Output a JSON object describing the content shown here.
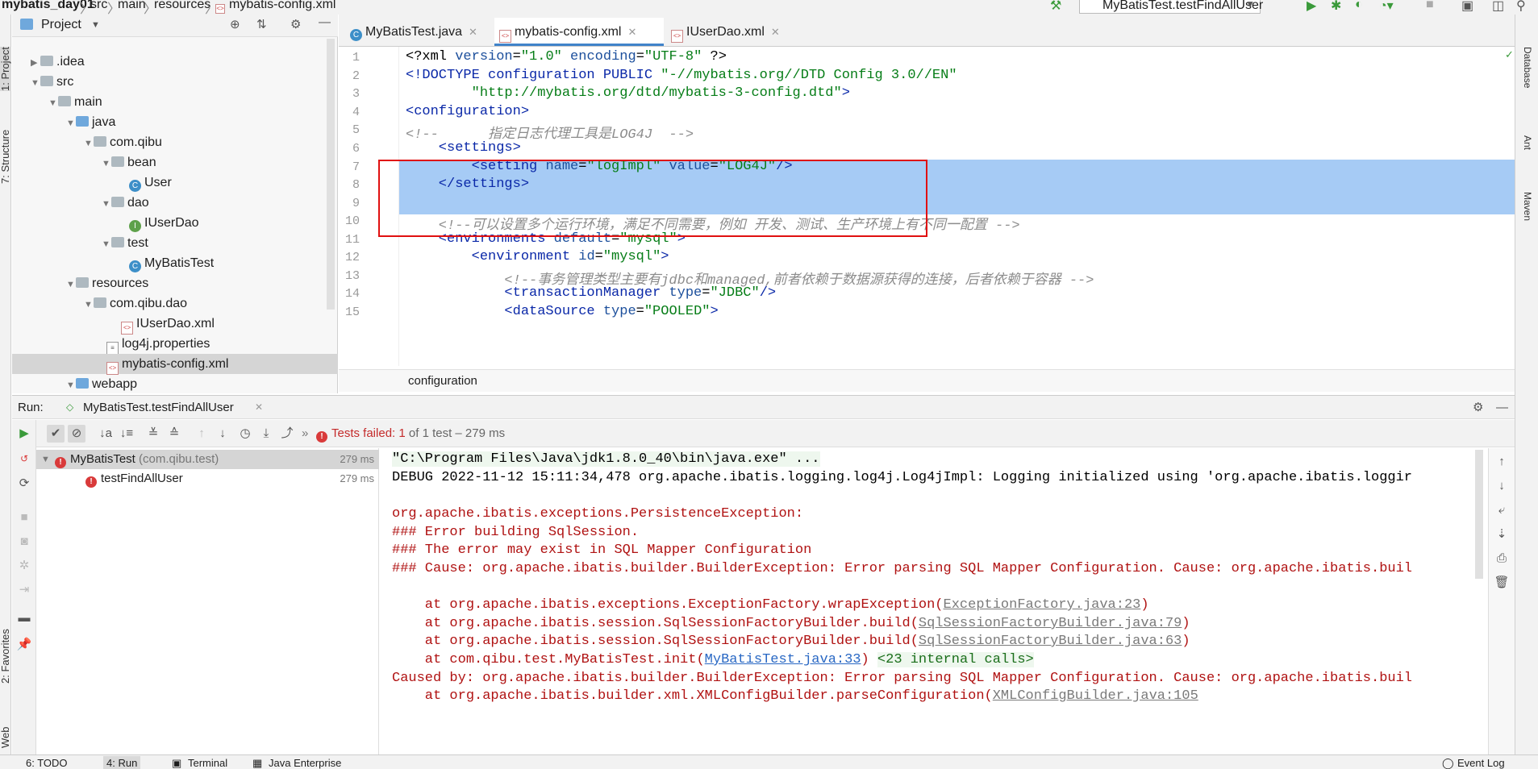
{
  "topbar": {
    "crumbs": [
      "mybatis_day01",
      "src",
      "main",
      "resources",
      "mybatis-config.xml"
    ],
    "run_config": "MyBatisTest.testFindAllUser"
  },
  "left_strip": {
    "project": "1: Project",
    "structure": "7: Structure",
    "favorites": "2: Favorites",
    "web": "Web"
  },
  "right_strip": {
    "database": "Database",
    "ant": "Ant",
    "maven": "Maven"
  },
  "project_panel": {
    "title": "Project",
    "tree": [
      {
        "label": ".idea",
        "kind": "folder"
      },
      {
        "label": "src",
        "kind": "folder"
      },
      {
        "label": "main",
        "kind": "folder"
      },
      {
        "label": "java",
        "kind": "folder-blue"
      },
      {
        "label": "com.qibu",
        "kind": "package"
      },
      {
        "label": "bean",
        "kind": "package"
      },
      {
        "label": "User",
        "kind": "class"
      },
      {
        "label": "dao",
        "kind": "package"
      },
      {
        "label": "IUserDao",
        "kind": "interface"
      },
      {
        "label": "test",
        "kind": "package"
      },
      {
        "label": "MyBatisTest",
        "kind": "class"
      },
      {
        "label": "resources",
        "kind": "folder"
      },
      {
        "label": "com.qibu.dao",
        "kind": "package"
      },
      {
        "label": "IUserDao.xml",
        "kind": "xml"
      },
      {
        "label": "log4j.properties",
        "kind": "properties"
      },
      {
        "label": "mybatis-config.xml",
        "kind": "xml"
      },
      {
        "label": "webapp",
        "kind": "folder"
      }
    ]
  },
  "tabs": [
    {
      "label": "MyBatisTest.java"
    },
    {
      "label": "mybatis-config.xml"
    },
    {
      "label": "IUserDao.xml"
    }
  ],
  "editor": {
    "line_numbers": [
      "1",
      "2",
      "3",
      "4",
      "5",
      "6",
      "7",
      "8",
      "9",
      "10",
      "11",
      "12",
      "13",
      "14",
      "15"
    ],
    "lines": {
      "l1a": "<?xml ",
      "l1b": "version",
      "l1c": "=",
      "l1d": "\"1.0\"",
      "l1e": " encoding",
      "l1f": "=",
      "l1g": "\"UTF-8\"",
      "l1h": " ?>",
      "l2a": "<!DOCTYPE configuration PUBLIC ",
      "l2b": "\"-//mybatis.org//DTD Config 3.0//EN\"",
      "l3": "        \"http://mybatis.org/dtd/mybatis-3-config.dtd\"",
      "l3end": ">",
      "l4": "<configuration>",
      "l5": "<!--      指定日志代理工具是LOG4J  -->",
      "l6": "    <settings>",
      "l7a": "        <setting ",
      "l7b": "name",
      "l7c": "=",
      "l7d": "\"logImpl\"",
      "l7e": " value",
      "l7f": "=",
      "l7g": "\"LOG4J\"",
      "l7h": "/>",
      "l8": "    </settings>",
      "l10": "    <!--可以设置多个运行环境，满足不同需要，例如 开发、测试、生产环境上有不同一配置 -->",
      "l11a": "    <environments ",
      "l11b": "default",
      "l11c": "=",
      "l11d": "\"mysql\"",
      "l11e": ">",
      "l12a": "        <environment ",
      "l12b": "id",
      "l12c": "=",
      "l12d": "\"mysql\"",
      "l12e": ">",
      "l13": "            <!--事务管理类型主要有jdbc和managed,前者依赖于数据源获得的连接，后者依赖于容器 -->",
      "l14a": "            <transactionManager ",
      "l14b": "type",
      "l14c": "=",
      "l14d": "\"JDBC\"",
      "l14e": "/>",
      "l15a": "            <dataSource ",
      "l15b": "type",
      "l15c": "=",
      "l15d": "\"POOLED\"",
      "l15e": ">"
    },
    "breadcrumb": "configuration"
  },
  "run_panel": {
    "run_label": "Run:",
    "run_tab": "MyBatisTest.testFindAllUser",
    "status_prefix": "Tests failed: ",
    "status_count": "1",
    "status_suffix": " of 1 test – 279 ms",
    "tests": [
      {
        "name": "MyBatisTest",
        "pkg": " (com.qibu.test)",
        "time": "279 ms"
      },
      {
        "name": "testFindAllUser",
        "pkg": "",
        "time": "279 ms"
      }
    ],
    "console": {
      "c1": "\"C:\\Program Files\\Java\\jdk1.8.0_40\\bin\\java.exe\" ...",
      "c2": "DEBUG 2022-11-12 15:11:34,478 org.apache.ibatis.logging.log4j.Log4jImpl: Logging initialized using 'org.apache.ibatis.loggir",
      "c4": "org.apache.ibatis.exceptions.PersistenceException:",
      "c5": "### Error building SqlSession.",
      "c6": "### The error may exist in SQL Mapper Configuration",
      "c7": "### Cause: org.apache.ibatis.builder.BuilderException: Error parsing SQL Mapper Configuration. Cause: org.apache.ibatis.buil",
      "c9a": "    at org.apache.ibatis.exceptions.ExceptionFactory.wrapException(",
      "c9b": "ExceptionFactory.java:23",
      "c9c": ")",
      "c10a": "    at org.apache.ibatis.session.SqlSessionFactoryBuilder.build(",
      "c10b": "SqlSessionFactoryBuilder.java:79",
      "c10c": ")",
      "c11a": "    at org.apache.ibatis.session.SqlSessionFactoryBuilder.build(",
      "c11b": "SqlSessionFactoryBuilder.java:63",
      "c11c": ")",
      "c12a": "    at com.qibu.test.MyBatisTest.init(",
      "c12b": "MyBatisTest.java:33",
      "c12c": ") ",
      "c12d": "<23 internal calls>",
      "c13": "Caused by: org.apache.ibatis.builder.BuilderException: Error parsing SQL Mapper Configuration. Cause: org.apache.ibatis.buil",
      "c14a": "    at org.apache.ibatis.builder.xml.XMLConfigBuilder.parseConfiguration(",
      "c14b": "XMLConfigBuilder.java:105"
    }
  },
  "statusbar": {
    "todo": "6: TODO",
    "run": "4: Run",
    "terminal": "Terminal",
    "java_enterprise": "Java Enterprise",
    "event_log": "Event Log"
  },
  "colors": {
    "accent": "#4083c9",
    "selection": "#a6cbf5",
    "highlight_box": "#e01010",
    "error": "#b01212"
  }
}
